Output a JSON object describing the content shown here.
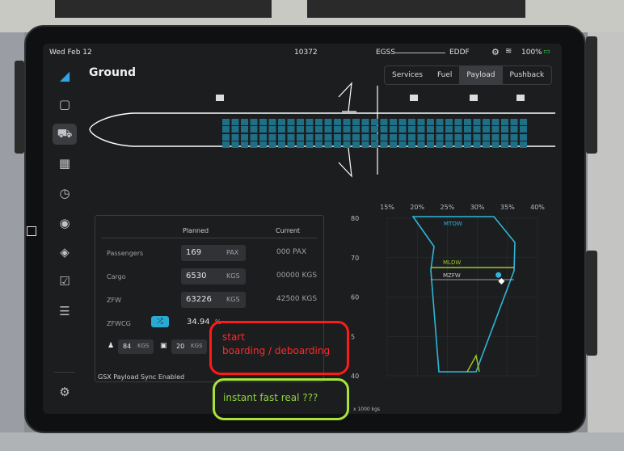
{
  "status_bar": {
    "date": "Wed Feb 12",
    "center": "10372",
    "origin": "EGSS",
    "destination": "EDDF",
    "battery": "100%"
  },
  "app": {
    "title": "Ground"
  },
  "tabs": [
    {
      "label": "Services"
    },
    {
      "label": "Fuel"
    },
    {
      "label": "Payload",
      "active": true
    },
    {
      "label": "Pushback"
    }
  ],
  "sidebar": [
    "clipboard-icon",
    "truck-icon",
    "calculator-icon",
    "gauge-icon",
    "radio-icon",
    "alert-icon",
    "checklist-icon",
    "sliders-icon",
    "settings-icon"
  ],
  "payload": {
    "headers": {
      "planned": "Planned",
      "current": "Current"
    },
    "rows": [
      {
        "label": "Passengers",
        "planned": "169",
        "unit": "PAX",
        "current": "000 PAX"
      },
      {
        "label": "Cargo",
        "planned": "6530",
        "unit": "KGS",
        "current": "00000 KGS"
      },
      {
        "label": "ZFW",
        "planned": "63226",
        "unit": "KGS",
        "current": "42500 KGS"
      },
      {
        "label": "ZFWCG",
        "planned": "34.94",
        "unit": "%",
        "current": ""
      }
    ],
    "cabin": {
      "pax_weight": "84",
      "pax_unit": "KGS",
      "bag_weight": "20",
      "bag_unit": "KGS"
    },
    "gsx_label": "GSX Payload Sync Enabled"
  },
  "chart_data": {
    "type": "scatter",
    "title": "",
    "x_ticks": [
      "15%",
      "20%",
      "25%",
      "30%",
      "35%",
      "40%"
    ],
    "y_ticks": [
      "80",
      "70",
      "60",
      "5",
      "40"
    ],
    "xlabel": "",
    "ylabel": "",
    "x_unit_note": "x 1000 kgs",
    "limit_lines": [
      {
        "name": "MTOW",
        "color": "#2fb6d6"
      },
      {
        "name": "MLDW",
        "color": "#9ccc2a"
      },
      {
        "name": "MZFW",
        "color": "#c8c8c8"
      }
    ],
    "points": [
      {
        "name": "planned",
        "x": 33.5,
        "y": 65.6,
        "color": "#2fb6d6"
      },
      {
        "name": "current",
        "x": 34.0,
        "y": 64.0,
        "color": "#ffffff"
      }
    ]
  },
  "annotations": {
    "red": {
      "line1": "start",
      "line2": "boarding / deboarding",
      "color": "#ff1a1a"
    },
    "green": {
      "text": "instant  fast  real ???",
      "color": "#a8e33a"
    }
  }
}
